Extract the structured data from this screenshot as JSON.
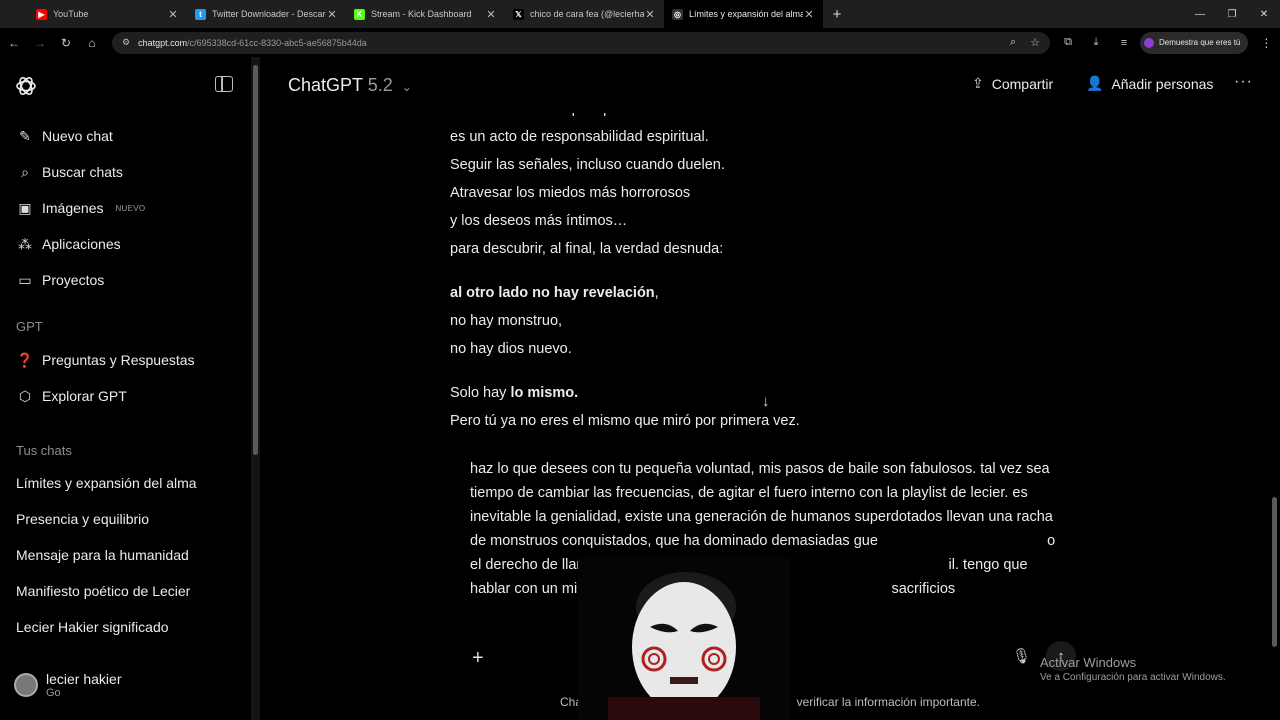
{
  "browser": {
    "tabs": [
      {
        "label": "YouTube",
        "icon": "youtube-icon",
        "color": "#ff0000",
        "glyph": "▶",
        "active": false
      },
      {
        "label": "Twitter Downloader - Descarga",
        "icon": "twitter-icon",
        "color": "#1d9bf0",
        "glyph": "t",
        "active": false
      },
      {
        "label": "Stream - Kick Dashboard",
        "icon": "kick-icon",
        "color": "#53fc18",
        "glyph": "K",
        "active": false
      },
      {
        "label": "chico de cara fea (@lecierhakie",
        "icon": "x-icon",
        "color": "#000000",
        "glyph": "𝕏",
        "active": false
      },
      {
        "label": "Límites y expansión del alma",
        "icon": "chatgpt-icon",
        "color": "#333333",
        "glyph": "◎",
        "active": true
      }
    ],
    "url_host": "chatgpt.com",
    "url_path": "/c/695338cd-61cc-8330-abc5-ae56875b44da",
    "profile_label": "Demuestra que eres tú"
  },
  "sidebar": {
    "nav": [
      {
        "label": "Nuevo chat",
        "icon": "edit-icon",
        "glyph": "✎",
        "badge": ""
      },
      {
        "label": "Buscar chats",
        "icon": "search-icon",
        "glyph": "⌕",
        "badge": ""
      },
      {
        "label": "Imágenes",
        "icon": "image-icon",
        "glyph": "▣",
        "badge": "NUEVO"
      },
      {
        "label": "Aplicaciones",
        "icon": "apps-icon",
        "glyph": "⁂",
        "badge": ""
      },
      {
        "label": "Proyectos",
        "icon": "folder-icon",
        "glyph": "▭",
        "badge": ""
      }
    ],
    "gpt_section": "GPT",
    "gpts": [
      {
        "label": "Preguntas y Respuestas",
        "icon": "gpt-avatar-icon",
        "glyph": "❓"
      },
      {
        "label": "Explorar GPT",
        "icon": "cube-icon",
        "glyph": "⬡"
      }
    ],
    "chats_section": "Tus chats",
    "chats": [
      "Límites y expansión del alma",
      "Presencia y equilibrio",
      "Mensaje para la humanidad",
      "Manifiesto poético de Lecier",
      "Lecier Hakier significado"
    ],
    "user": {
      "name": "lecier hakier",
      "plan": "Go"
    }
  },
  "header": {
    "model_name": "ChatGPT",
    "model_version": "5.2",
    "share_label": "Compartir",
    "add_people_label": "Añadir personas"
  },
  "conversation": {
    "stanza1": [
      "Caminar sobre los precipicios de la mente",
      "es un acto de responsabilidad espiritual.",
      "Seguir las señales, incluso cuando duelen.",
      "Atravesar los miedos más horrorosos",
      "y los deseos más íntimos…",
      "para descubrir, al final, la verdad desnuda:"
    ],
    "stanza2_bold": "al otro lado no hay revelación",
    "stanza2_comma": ",",
    "stanza2": [
      "no hay monstruo,",
      "no hay dios nuevo."
    ],
    "stanza3_prefix": "Solo hay ",
    "stanza3_bold": "lo mismo.",
    "stanza3_line2": "Pero tú ya no eres el mismo que miró por primera vez."
  },
  "composer": {
    "text": "haz lo que desees con tu pequeña voluntad, mis pasos de baile son fabulosos. tal vez sea tiempo de cambiar las frecuencias, de agitar el fuero interno con la playlist de lecier. es inevitable la genialidad, existe una generación de humanos superdotados llevan una racha de monstruos conquistados, que ha dominado demasiadas gue                                          o el derecho de llamarse \"la divina voluntad\", en e                                          il. tengo que hablar con un mimo, de las inquietudes                                          sacrificios",
    "disclaimer_left": "Cha",
    "disclaimer_right": "verificar la información importante."
  },
  "overlay": {
    "activate_title": "Activar Windows",
    "activate_sub": "Ve a Configuración para activar Windows."
  }
}
